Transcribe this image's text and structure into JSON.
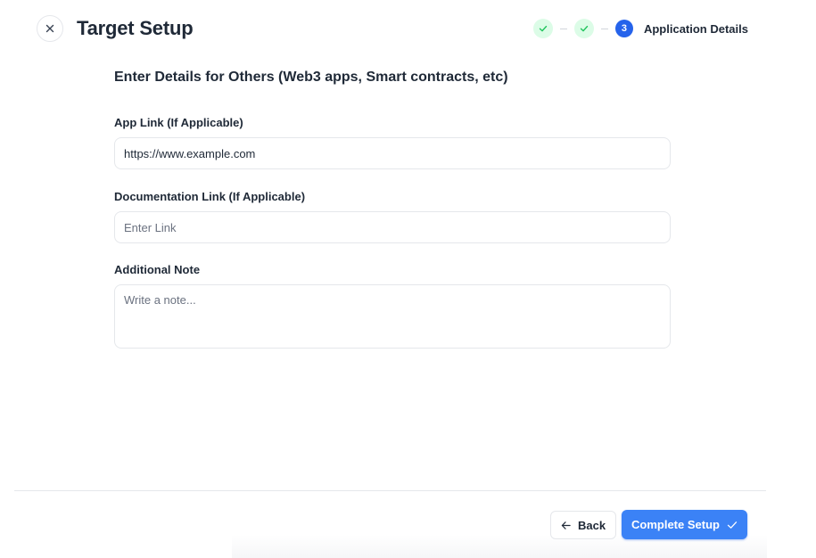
{
  "header": {
    "title": "Target Setup",
    "close_icon": "close-icon"
  },
  "stepper": {
    "steps": [
      {
        "status": "complete",
        "icon": "check-icon"
      },
      {
        "status": "complete",
        "icon": "check-icon"
      },
      {
        "status": "current",
        "number": "3",
        "label": "Application Details"
      }
    ],
    "colors": {
      "complete_bg": "#dcfce7",
      "complete_check": "#22c55e",
      "current_bg": "#2563eb"
    }
  },
  "form": {
    "section_title": "Enter Details for Others (Web3 apps, Smart contracts, etc)",
    "app_link": {
      "label": "App Link (If Applicable)",
      "value": "https://www.example.com"
    },
    "documentation_link": {
      "label": "Documentation Link (If Applicable)",
      "placeholder": "Enter Link",
      "value": ""
    },
    "additional_note": {
      "label": "Additional Note",
      "placeholder": "Write a note...",
      "value": ""
    }
  },
  "footer": {
    "back_label": "Back",
    "back_icon": "arrow-left-icon",
    "complete_label": "Complete Setup",
    "complete_icon": "check-icon",
    "accent_color": "#3b82f6"
  }
}
